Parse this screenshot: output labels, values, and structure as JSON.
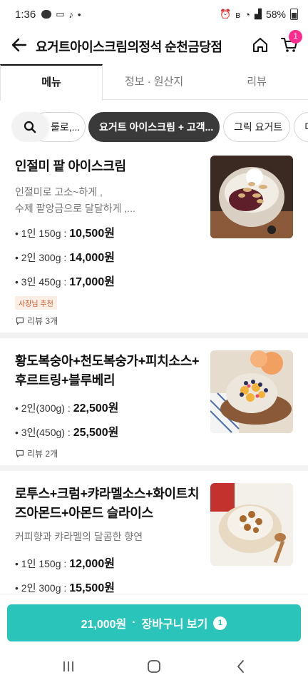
{
  "status": {
    "time": "1:36",
    "battery": "58%"
  },
  "header": {
    "title": "요거트아이스크림의정석 순천금당점",
    "cart_count": "1"
  },
  "tabs": [
    "메뉴",
    "정보 · 원산지",
    "리뷰"
  ],
  "chips": {
    "items": [
      "룰로,...",
      "요거트 아이스크림 + 고객...",
      "그릭 요거트",
      "디"
    ]
  },
  "menu": [
    {
      "name": "인절미 팥 아이스크림",
      "desc": [
        "인절미로 고소~하게 ,",
        "수제 팥앙금으로 달달하게 ,..."
      ],
      "prices": [
        {
          "label": "• 1인 150g :",
          "price": "10,500원"
        },
        {
          "label": "• 2인 300g :",
          "price": "14,000원"
        },
        {
          "label": "• 3인 450g :",
          "price": "17,000원"
        }
      ],
      "badge": "사장님 추천",
      "review": "리뷰 3개"
    },
    {
      "name": [
        "황도복숭아+천도복숭가+피치소스+",
        "후르트링+블루베리"
      ],
      "prices": [
        {
          "label": "• 2인(300g) :",
          "price": "22,500원"
        },
        {
          "label": "• 3인(450g) :",
          "price": "25,500원"
        }
      ],
      "review": "리뷰 2개"
    },
    {
      "name": [
        "로투스+크럼+캬라멜소스+화이트치",
        "즈아몬드+아몬드 슬라이스"
      ],
      "desc": [
        "커피향과 캬라멜의 달콤한 향연"
      ],
      "prices": [
        {
          "label": "• 1인 150g :",
          "price": "12,000원"
        },
        {
          "label": "• 2인 300g :",
          "price": "15,500원"
        }
      ]
    }
  ],
  "cart_bar": {
    "amount": "21,000원",
    "sep": "·",
    "label": "장바구니 보기",
    "count": "1"
  },
  "colors": {
    "accent": "#2bc4ba",
    "badge_pink": "#ff2e8e",
    "chip_active": "#3a3a3a"
  }
}
